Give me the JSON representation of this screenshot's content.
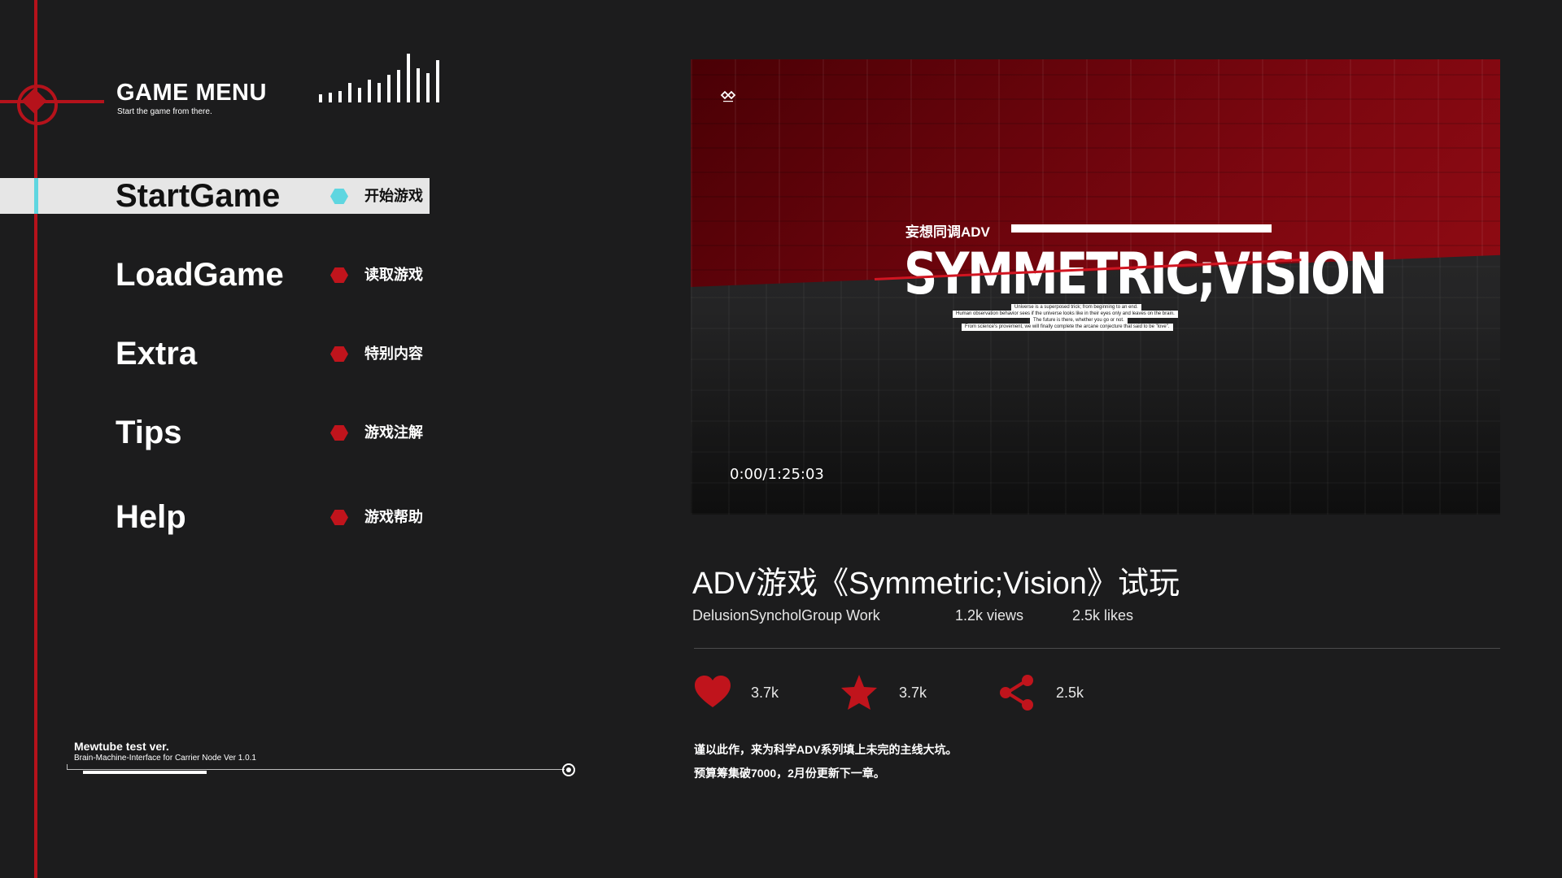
{
  "header": {
    "title": "GAME MENU",
    "subtitle": "Start the game from there."
  },
  "menu": {
    "items": [
      {
        "label": "StartGame",
        "cn": "开始游戏",
        "active": true
      },
      {
        "label": "LoadGame",
        "cn": "读取游戏",
        "active": false
      },
      {
        "label": "Extra",
        "cn": "特别内容",
        "active": false
      },
      {
        "label": "Tips",
        "cn": "游戏注解",
        "active": false
      },
      {
        "label": "Help",
        "cn": "游戏帮助",
        "active": false
      }
    ]
  },
  "version": {
    "title": "Mewtube test ver.",
    "subtitle": "Brain-Machine-Interface for Carrier Node Ver 1.0.1"
  },
  "video": {
    "kicker": "妄想同调ADV",
    "logo": "SYMMETRIC;VISION",
    "taglines": [
      "Universe is a superposed trick; from beginning to an end.",
      "Human observation behavior sees if the universe looks like in their eyes only and leaves on the brain.",
      "The future is there, whether you go or not.",
      "From science's provement, we will finally complete the arcane conjecture that said to be \"love\"."
    ],
    "timecode": "0:00/1:25:03",
    "title": "ADV游戏《Symmetric;Vision》试玩",
    "author": "DelusionSyncholGroup Work",
    "views": "1.2k views",
    "likes": "2.5k likes"
  },
  "stats": {
    "hearts": "3.7k",
    "stars": "3.7k",
    "shares": "2.5k"
  },
  "description": [
    "谨以此作，来为科学ADV系列填上未完的主线大坑。",
    "预算筹集破7000，2月份更新下一章。"
  ],
  "icons": {
    "heart": "heart-icon",
    "star": "star-icon",
    "share": "share-icon"
  },
  "colors": {
    "accent_red": "#b5121b",
    "accent_cyan": "#5fd6e0",
    "background": "#1c1c1d"
  }
}
